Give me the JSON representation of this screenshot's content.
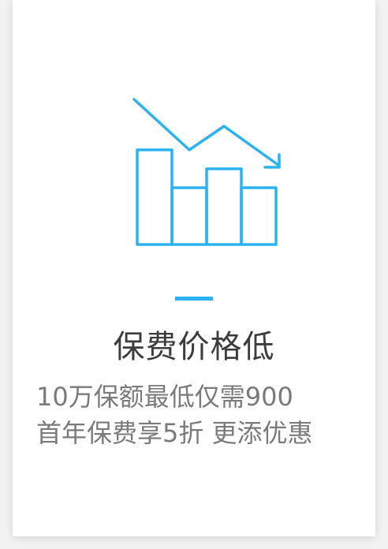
{
  "feature": {
    "icon": "price-decline-chart-icon",
    "title": "保费价格低",
    "description_lines": [
      "10万保额最低仅需900",
      "首年保费享5折 更添优惠"
    ]
  },
  "colors": {
    "accent": "#2bb3f0",
    "title": "#3c3c3c",
    "text": "#7a7a7a",
    "card": "#ffffff",
    "background": "#f2f2f2"
  }
}
